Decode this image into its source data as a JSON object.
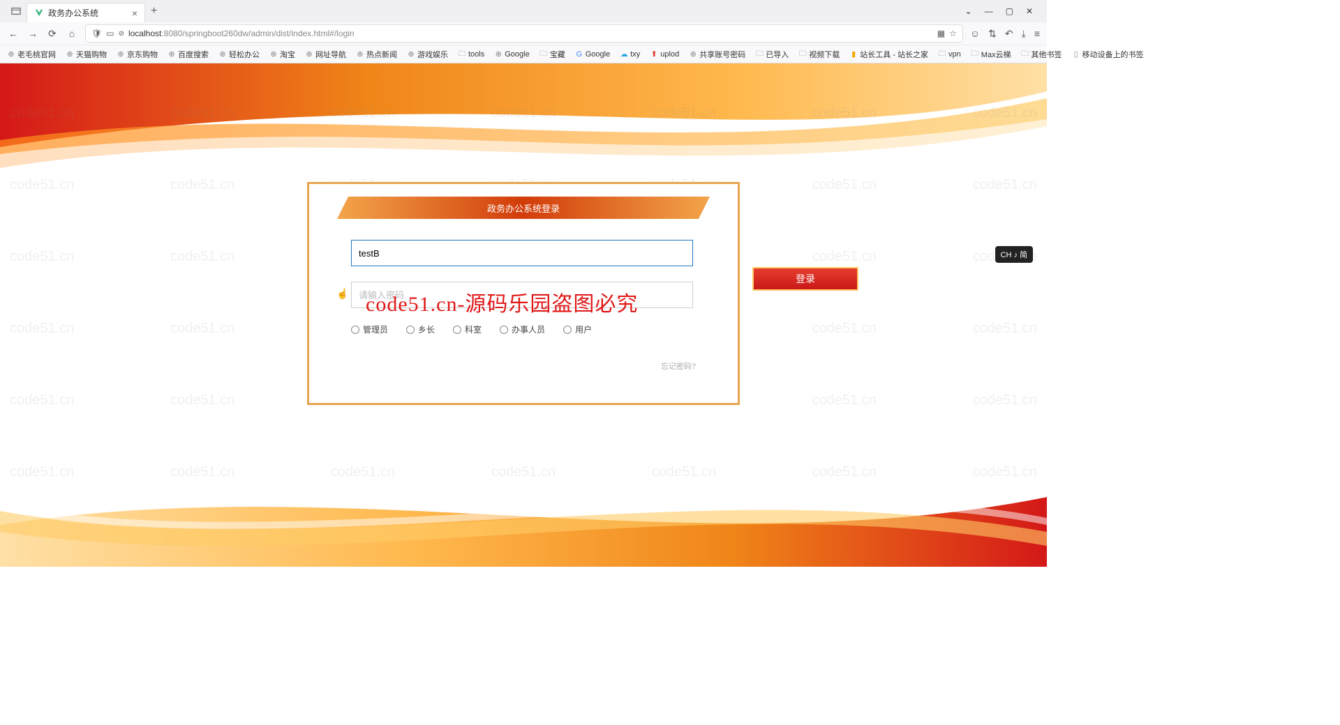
{
  "browser": {
    "tab_title": "政务办公系统",
    "url_prefix": "localhost",
    "url_path": ":8080/springboot260dw/admin/dist/index.html#/login",
    "bookmarks": [
      "老毛桃官网",
      "天猫购物",
      "京东购物",
      "百度搜索",
      "轻松办公",
      "淘宝",
      "网址导航",
      "热点新闻",
      "游戏娱乐",
      "tools",
      "Google",
      "宝藏",
      "Google",
      "txy",
      "uplod",
      "共享账号密码",
      "已导入",
      "视频下载",
      "站长工具 - 站长之家",
      "vpn",
      "Max云梯"
    ],
    "bookmarks_right": [
      "其他书签",
      "移动设备上的书签"
    ]
  },
  "login": {
    "header": "政务办公系统登录",
    "username_value": "testB",
    "password_placeholder": "请输入密码",
    "roles": [
      "管理员",
      "乡长",
      "科室",
      "办事人员",
      "用户"
    ],
    "forgot": "忘记密码?",
    "button": "登录"
  },
  "overlay": "code51.cn-源码乐园盗图必究",
  "watermark": "code51.cn",
  "ime": "CH ♪ 简"
}
